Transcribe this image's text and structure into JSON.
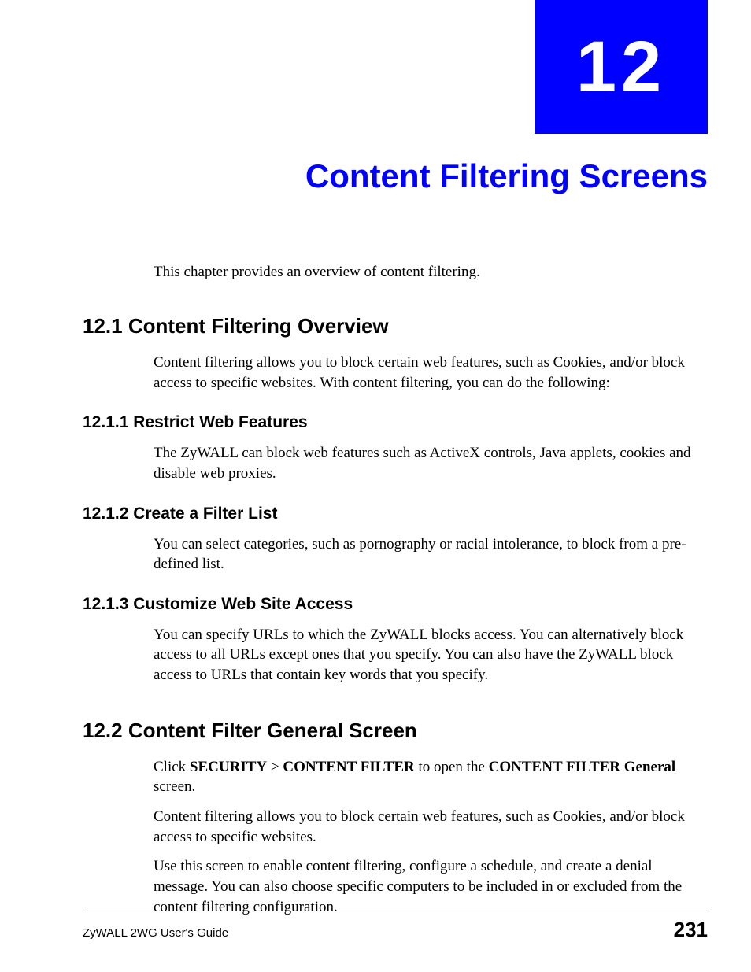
{
  "chapter": {
    "number": "12",
    "title": "Content Filtering Screens"
  },
  "intro": "This chapter provides an overview of content filtering.",
  "sections": {
    "s1": {
      "heading": "12.1  Content Filtering Overview",
      "body": "Content filtering allows you to block certain web features, such as Cookies, and/or block access to specific websites. With content filtering, you can do the following:",
      "subs": {
        "s1_1": {
          "heading": "12.1.1  Restrict Web Features",
          "body": "The ZyWALL can block web features such as ActiveX controls, Java applets, cookies and disable web proxies."
        },
        "s1_2": {
          "heading": "12.1.2  Create a Filter List",
          "body": "You can select categories, such as pornography or racial intolerance, to block from a pre-defined list."
        },
        "s1_3": {
          "heading": "12.1.3  Customize Web Site Access",
          "body": "You can specify URLs to which the ZyWALL blocks access. You can alternatively block access to all URLs except ones that you specify. You can also have the ZyWALL block access to URLs that contain key words that you specify."
        }
      }
    },
    "s2": {
      "heading": "12.2  Content Filter General Screen",
      "p1_pre": "Click ",
      "p1_b1": "SECURITY",
      "p1_mid1": " > ",
      "p1_b2": "CONTENT FILTER",
      "p1_mid2": " to open the ",
      "p1_b3": "CONTENT FILTER General",
      "p1_post": " screen.",
      "p2": "Content filtering allows you to block certain web features, such as Cookies, and/or block access to specific websites.",
      "p3": "Use this screen to enable content filtering, configure a schedule, and create a denial message. You can also choose specific computers to be included in or excluded from the content filtering configuration."
    }
  },
  "footer": {
    "guide": "ZyWALL 2WG User's Guide",
    "page": "231"
  }
}
